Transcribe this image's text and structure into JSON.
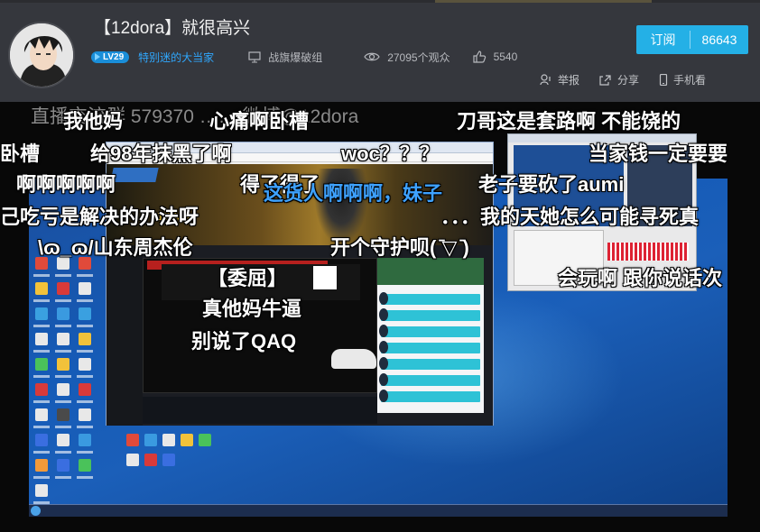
{
  "header": {
    "title": "【12dora】就很高兴",
    "level": "LV29",
    "fan_title": "特别迷的大当家",
    "category": "战旗爆破组",
    "viewers": "27095个观众",
    "likes": "5540",
    "subscribe_label": "订阅",
    "subscribe_count": "86643",
    "actions": {
      "report": "举报",
      "share": "分享",
      "mobile": "手机看"
    }
  },
  "stream": {
    "site_name": "12dora",
    "danmaku": [
      "直播交流群 579370 …… 微博@12dora",
      "我他妈",
      "心痛啊卧槽",
      "刀哥这是套路啊 不能饶的",
      "卧槽",
      "给98年抹黑了啊",
      "woc？？？",
      "当家钱一定要要",
      "啊啊啊啊啊",
      "得了得了",
      "这货人啊啊啊，妹子",
      "老子要砍了aumi",
      "己吃亏是解决的办法呀",
      "．．．我的天她怎么可能寻死真",
      "\\ɷ_ɷ/山东周杰伦",
      "开个守护呗( ̄▽ ̄)",
      "【委屈】",
      "会玩啊 跟你说话次",
      "真他妈牛逼",
      "别说了QAQ"
    ]
  },
  "colors": {
    "accent": "#24b0e6",
    "level_badge": "#1a8ed9",
    "fan_title": "#2fa8ff",
    "danmaku_blue": "#3ea2ff"
  }
}
